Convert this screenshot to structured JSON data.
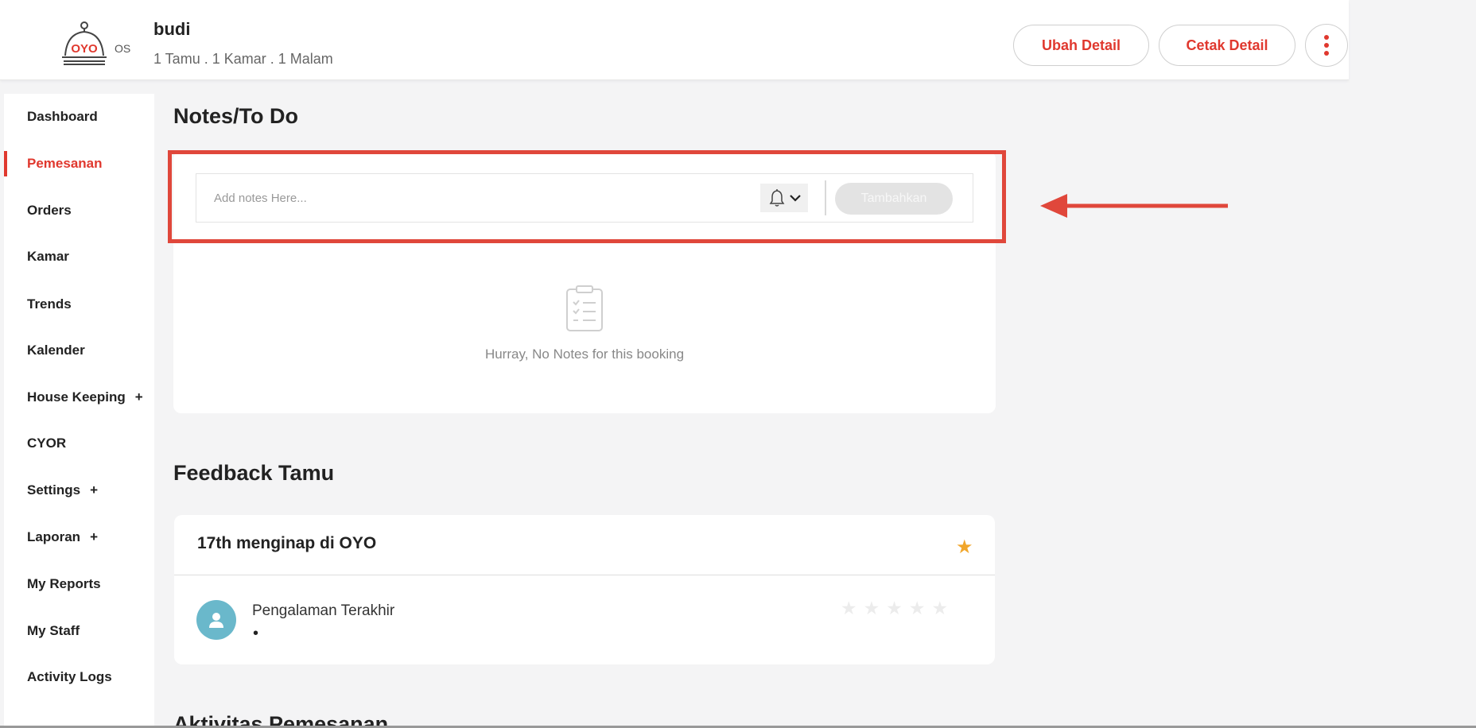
{
  "header": {
    "logo_text": "OYO",
    "logo_suffix": "OS",
    "guest_name": "budi",
    "guest_meta": "1 Tamu . 1 Kamar . 1 Malam",
    "edit_button": "Ubah Detail",
    "print_button": "Cetak Detail",
    "more_icon": "vertical-dots-icon"
  },
  "sidebar": {
    "items": [
      {
        "label": "Dashboard",
        "active": false,
        "expandable": false
      },
      {
        "label": "Pemesanan",
        "active": true,
        "expandable": false
      },
      {
        "label": "Orders",
        "active": false,
        "expandable": false
      },
      {
        "label": "Kamar",
        "active": false,
        "expandable": false
      },
      {
        "label": "Trends",
        "active": false,
        "expandable": false
      },
      {
        "label": "Kalender",
        "active": false,
        "expandable": false
      },
      {
        "label": "House Keeping",
        "active": false,
        "expandable": true
      },
      {
        "label": "CYOR",
        "active": false,
        "expandable": false
      },
      {
        "label": "Settings",
        "active": false,
        "expandable": true
      },
      {
        "label": "Laporan",
        "active": false,
        "expandable": true
      },
      {
        "label": "My Reports",
        "active": false,
        "expandable": false
      },
      {
        "label": "My Staff",
        "active": false,
        "expandable": false
      },
      {
        "label": "Activity Logs",
        "active": false,
        "expandable": false
      }
    ],
    "expand_symbol": "+"
  },
  "notes": {
    "title": "Notes/To Do",
    "input_placeholder": "Add notes Here...",
    "add_button": "Tambahkan",
    "empty_text": "Hurray, No Notes for this booking"
  },
  "feedback": {
    "title": "Feedback Tamu",
    "stay_text": "17th menginap di OYO",
    "experience_label": "Pengalaman Terakhir",
    "experience_value": "•",
    "rating": 0,
    "rating_max": 5
  },
  "activity": {
    "title": "Aktivitas Pemesanan"
  },
  "colors": {
    "accent": "#e0382e",
    "highlight": "#e0473b",
    "star": "#f1a62b",
    "avatar": "#6ab8cb"
  }
}
